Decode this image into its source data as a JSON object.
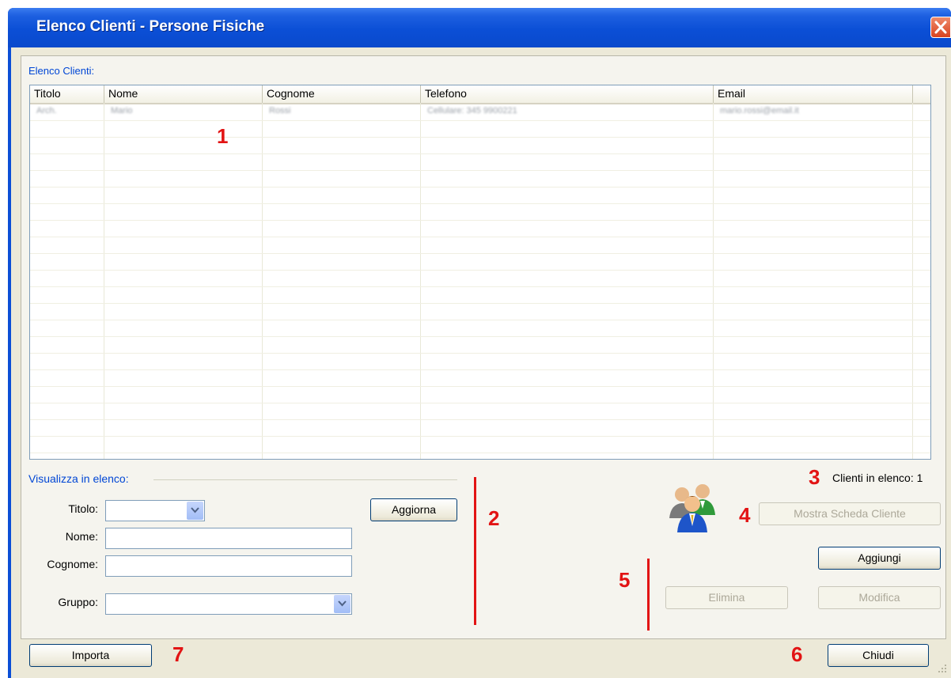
{
  "window": {
    "title": "Elenco Clienti - Persone Fisiche"
  },
  "list": {
    "label": "Elenco Clienti:",
    "columns": [
      "Titolo",
      "Nome",
      "Cognome",
      "Telefono",
      "Email"
    ],
    "rows": [
      {
        "titolo": "Arch.",
        "nome": "Mario",
        "cognome": "Rossi",
        "telefono": "Cellulare:   345 9900221",
        "email": "mario.rossi@email.it"
      }
    ]
  },
  "filter": {
    "label": "Visualizza in elenco:",
    "titolo_label": "Titolo:",
    "nome_label": "Nome:",
    "cognome_label": "Cognome:",
    "gruppo_label": "Gruppo:",
    "refresh_button": "Aggiorna"
  },
  "status": {
    "count_text": "Clienti in elenco: 1"
  },
  "buttons": {
    "show_card": "Mostra Scheda Cliente",
    "add": "Aggiungi",
    "delete": "Elimina",
    "edit": "Modifica",
    "import": "Importa",
    "close": "Chiudi"
  },
  "markers": [
    "1",
    "2",
    "3",
    "4",
    "5",
    "6",
    "7"
  ],
  "icons": {
    "clients": "people-group-icon",
    "close": "close-icon",
    "dropdown": "chevron-down-icon",
    "grip": "resize-grip-icon"
  },
  "colors": {
    "titlebar": "#0b4fd6",
    "label_blue": "#0046d5",
    "marker_red": "#e21414",
    "face": "#ece9d8"
  }
}
